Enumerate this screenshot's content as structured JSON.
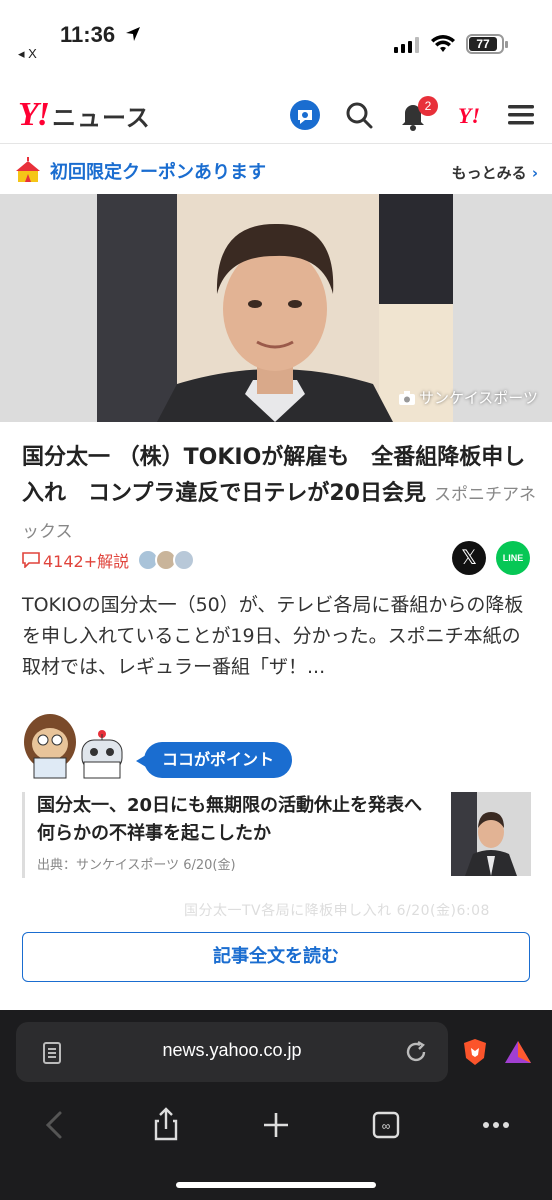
{
  "status_bar": {
    "time": "11:36",
    "back_label": "◂ X",
    "battery": "77"
  },
  "header": {
    "logo_y": "Y!",
    "logo_text": "ニュース",
    "notif_count": "2",
    "yahoo_mini": "Y!"
  },
  "coupon": {
    "label": "初回限定クーポンあります",
    "more": "もっとみる"
  },
  "hero": {
    "credit": "サンケイスポーツ"
  },
  "article": {
    "headline": "国分太一 （株）TOKIOが解雇も　全番組降板申し入れ　コンプラ違反で日テレが20日会見",
    "source": "スポニチアネックス",
    "comments": "4142+解説",
    "summary": "TOKIOの国分太一（50）が、テレビ各局に番組からの降板を申し入れていることが19日、分かった。スポニチ本紙の取材では、レギュラー番組「ザ！..."
  },
  "point": {
    "badge": "ココがポイント",
    "related_title": "国分太一、20日にも無期限の活動休止を発表へ　何らかの不祥事を起こしたか",
    "related_source": "出典：サンケイスポーツ 6/20(金)"
  },
  "faded_text": "国分太一TV各局に降板申し入れ 6/20(金)6:08",
  "read_all": "記事全文を読む",
  "browser": {
    "url": "news.yahoo.co.jp"
  },
  "colors": {
    "brand_red": "#ff0033",
    "link_blue": "#1a6dd0",
    "comment_red": "#e0443c"
  }
}
